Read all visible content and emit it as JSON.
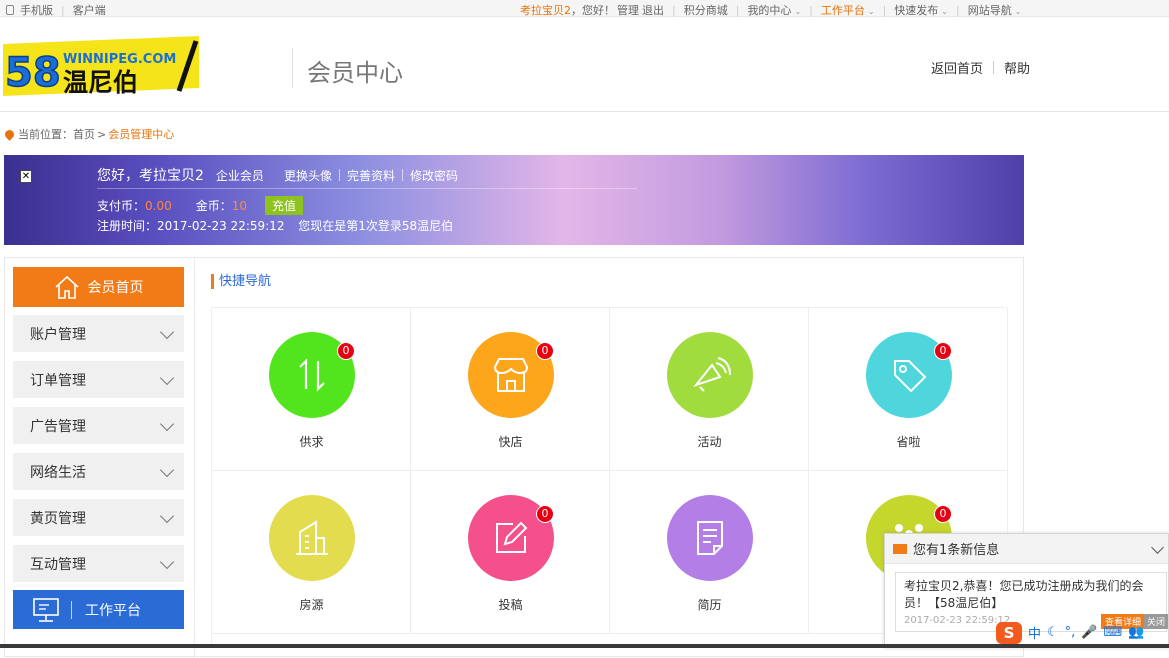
{
  "topbar": {
    "mobile": "手机版",
    "client": "客户端",
    "username": "考拉宝贝2",
    "greeting": "，您好！",
    "manage": "管理",
    "logout": "退出",
    "links": [
      {
        "label": "积分商城",
        "caret": false,
        "orange": false
      },
      {
        "label": "我的中心",
        "caret": true,
        "orange": false
      },
      {
        "label": "工作平台",
        "caret": true,
        "orange": true
      },
      {
        "label": "快速发布",
        "caret": true,
        "orange": false
      },
      {
        "label": "网站导航",
        "caret": true,
        "orange": false
      }
    ]
  },
  "header": {
    "logo_top": "WINNIPEG.COM",
    "logo_num": "58",
    "logo_cn": "温尼伯",
    "title": "会员中心",
    "back_home": "返回首页",
    "help": "帮助"
  },
  "breadcrumb": {
    "prefix": "当前位置：",
    "home": "首页",
    "arrow": ">",
    "current": "会员管理中心"
  },
  "banner": {
    "hello": "您好，考拉宝贝2",
    "member_type": "企业会员",
    "links": [
      "更换头像",
      "完善资料",
      "修改密码"
    ],
    "pay_label": "支付币：",
    "pay_value": "0.00",
    "gold_label": "金币：",
    "gold_value": "10",
    "recharge": "充值",
    "reg_time": "注册时间：2017-02-23 22:59:12",
    "login_info": "您现在是第1次登录58温尼伯"
  },
  "sidebar": {
    "home": "会员首页",
    "items": [
      "账户管理",
      "订单管理",
      "广告管理",
      "网络生活",
      "黄页管理",
      "互动管理"
    ],
    "work": "工作平台"
  },
  "quicknav": {
    "title": "快捷导航",
    "cells": [
      {
        "label": "供求",
        "badge": "0",
        "color": "#52e51e",
        "icon": "exchange-icon"
      },
      {
        "label": "快店",
        "badge": "0",
        "color": "#fda61b",
        "icon": "shop-icon"
      },
      {
        "label": "活动",
        "badge": "",
        "color": "#a1dc3f",
        "icon": "megaphone-icon"
      },
      {
        "label": "省啦",
        "badge": "0",
        "color": "#4fd6dd",
        "icon": "tag-icon"
      },
      {
        "label": "房源",
        "badge": "",
        "color": "#e3dc4f",
        "icon": "building-icon"
      },
      {
        "label": "投稿",
        "badge": "0",
        "color": "#f4508b",
        "icon": "edit-icon"
      },
      {
        "label": "简历",
        "badge": "",
        "color": "#b37ee6",
        "icon": "resume-icon"
      },
      {
        "label": "",
        "badge": "0",
        "color": "#c5d62c",
        "icon": "people-icon"
      }
    ]
  },
  "notification": {
    "title": "您有1条新信息",
    "message": "考拉宝贝2,恭喜！您已成功注册成为我们的会员！【58温尼伯】",
    "time": "2017-02-23 22:59:12",
    "view": "查看详细",
    "close": "关闭"
  },
  "ime": {
    "logo": "S",
    "mode": "中"
  }
}
